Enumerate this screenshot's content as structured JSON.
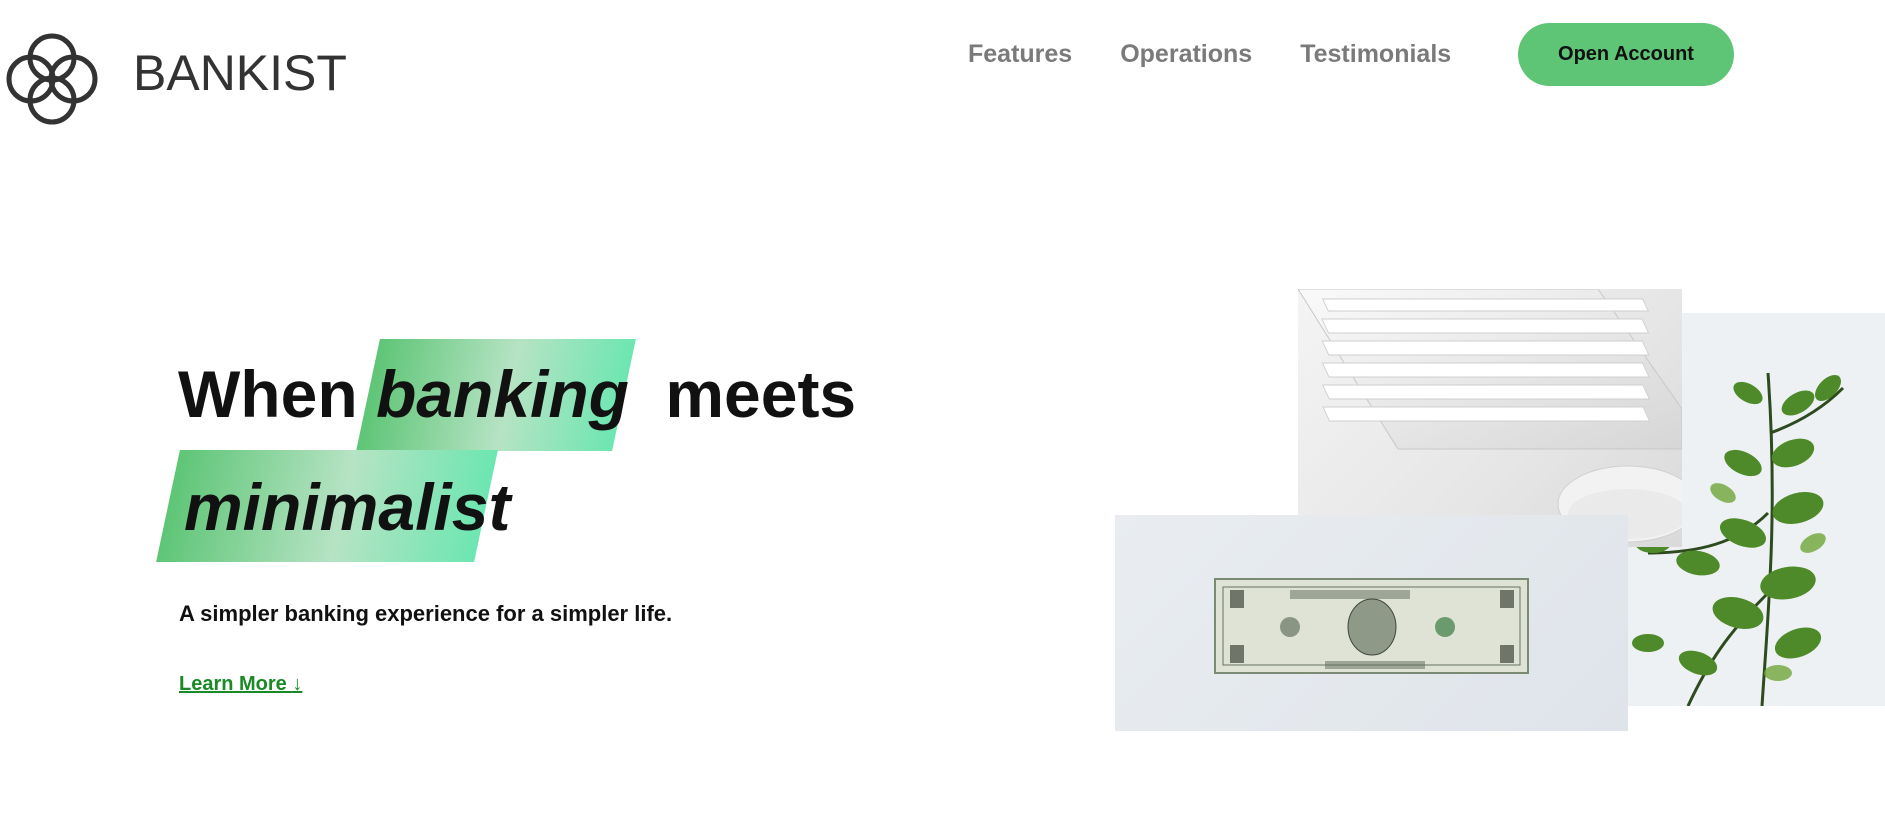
{
  "header": {
    "brand": "BANKIST",
    "logo_icon": "interlocking-circles-logo",
    "nav": [
      {
        "label": "Features"
      },
      {
        "label": "Operations"
      },
      {
        "label": "Testimonials"
      }
    ],
    "cta_label": "Open Account"
  },
  "hero": {
    "line1_before": "When",
    "line1_highlight": "banking",
    "line1_after": "meets",
    "line2_highlight": "minimalist",
    "subtitle": "A simpler banking experience for a simpler life.",
    "learn_more": "Learn More ↓"
  },
  "images": {
    "keyboard": "keyboard-and-mouse-photo",
    "dollar": "dollar-bill-photo",
    "plant": "eucalyptus-plant-photo"
  },
  "colors": {
    "accent": "#5ec576",
    "accent_light": "#6de6b1",
    "link": "#198a26",
    "nav_text": "#7a7a7a"
  }
}
